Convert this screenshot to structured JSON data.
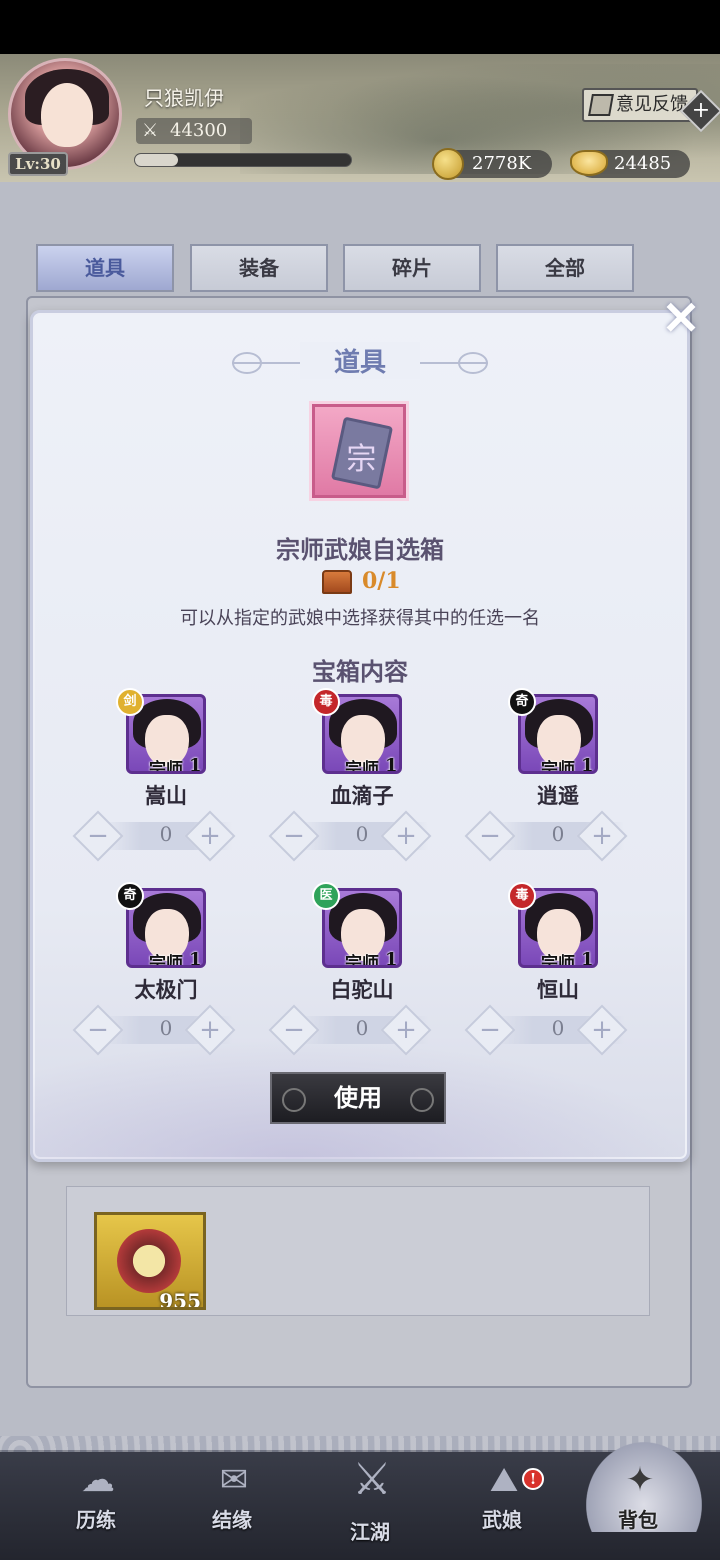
{
  "player": {
    "name": "只狼凯伊",
    "level": "Lv:30",
    "power": "44300",
    "exp_progress": 0.2
  },
  "header": {
    "feedback_label": "意见反馈",
    "coins": "2778K",
    "gold": "24485",
    "add_label": "+"
  },
  "tabs": [
    {
      "label": "道具",
      "active": true
    },
    {
      "label": "装备",
      "active": false
    },
    {
      "label": "碎片",
      "active": false
    },
    {
      "label": "全部",
      "active": false
    }
  ],
  "dialog": {
    "title": "道具",
    "close_label": "✕",
    "item_glyph": "宗",
    "item_name": "宗师武娘自选箱",
    "owned": "0/1",
    "description": "可以从指定的武娘中选择获得其中的任选一名",
    "contents_title": "宝箱内容",
    "use_label": "使用",
    "heroes": [
      {
        "name": "嵩山",
        "rank": "宗师",
        "count": "1",
        "badge": "剑",
        "badge_color": "#e0b12f",
        "value": "0"
      },
      {
        "name": "血滴子",
        "rank": "宗师",
        "count": "1",
        "badge": "毒",
        "badge_color": "#c4272a",
        "value": "0"
      },
      {
        "name": "逍遥",
        "rank": "宗师",
        "count": "1",
        "badge": "奇",
        "badge_color": "#111111",
        "value": "0"
      },
      {
        "name": "太极门",
        "rank": "宗师",
        "count": "1",
        "badge": "奇",
        "badge_color": "#111111",
        "value": "0"
      },
      {
        "name": "白驼山",
        "rank": "宗师",
        "count": "1",
        "badge": "医",
        "badge_color": "#2fa35a",
        "value": "0"
      },
      {
        "name": "恒山",
        "rank": "宗师",
        "count": "1",
        "badge": "毒",
        "badge_color": "#c4272a",
        "value": "0"
      }
    ],
    "minus_label": "−",
    "plus_label": "+"
  },
  "backpack": {
    "item_count": "955"
  },
  "nav": [
    {
      "label": "历练",
      "icon": "cloud-icon",
      "glyph": "☁"
    },
    {
      "label": "结缘",
      "icon": "fan-icon",
      "glyph": "✉"
    },
    {
      "label": "江湖",
      "icon": "crossed-swords-icon",
      "glyph": "⚔"
    },
    {
      "label": "武娘",
      "icon": "straw-hat-icon",
      "glyph": "⛰",
      "notice": "!"
    },
    {
      "label": "背包",
      "icon": "bag-icon",
      "glyph": "✦",
      "active": true
    }
  ]
}
